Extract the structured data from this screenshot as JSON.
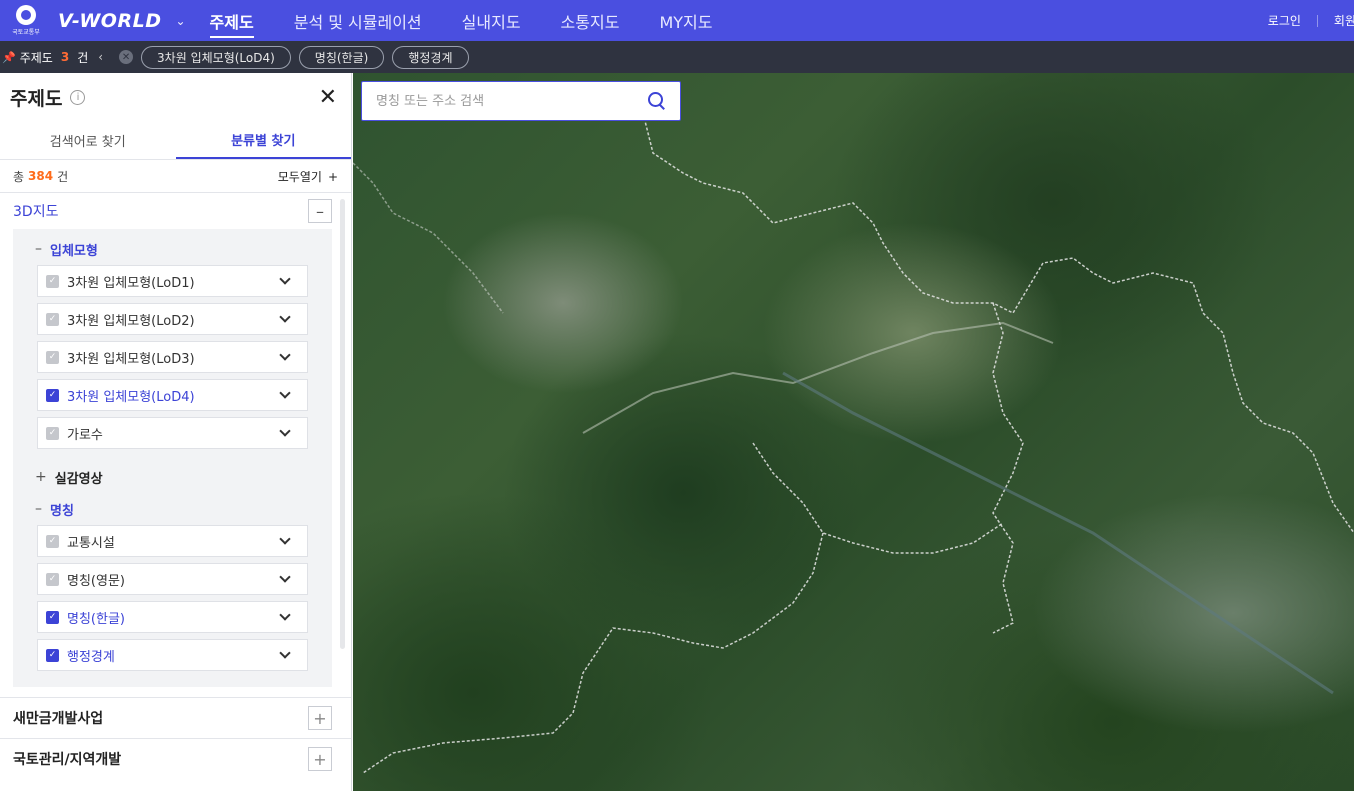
{
  "header": {
    "ministry": "국토교통부",
    "brand": "V-WORLD",
    "nav": [
      "주제도",
      "분석 및 시뮬레이션",
      "실내지도",
      "소통지도",
      "MY지도"
    ],
    "login": "로그인",
    "member": "회원"
  },
  "subbar": {
    "label": "주제도",
    "count": "3",
    "unit": "건",
    "chips": [
      "3차원 입체모형(LoD4)",
      "명칭(한글)",
      "행정경계"
    ]
  },
  "panel": {
    "title": "주제도",
    "tabs": [
      "검색어로 찾기",
      "분류별 찾기"
    ],
    "summary_prefix": "총",
    "summary_count": "384",
    "summary_suffix": "건",
    "expand_all": "모두열기",
    "category_3d": "3D지도",
    "group_model": "입체모형",
    "model_layers": [
      {
        "label": "3차원 입체모형(LoD1)",
        "checked": false
      },
      {
        "label": "3차원 입체모형(LoD2)",
        "checked": false
      },
      {
        "label": "3차원 입체모형(LoD3)",
        "checked": false
      },
      {
        "label": "3차원 입체모형(LoD4)",
        "checked": true
      },
      {
        "label": "가로수",
        "checked": false
      }
    ],
    "group_imagery": "실감영상",
    "group_names": "명칭",
    "name_layers": [
      {
        "label": "교통시설",
        "checked": false
      },
      {
        "label": "명칭(영문)",
        "checked": false
      },
      {
        "label": "명칭(한글)",
        "checked": true
      },
      {
        "label": "행정경계",
        "checked": true
      }
    ],
    "category_2": "새만금개발사업",
    "category_3": "국토관리/지역개발"
  },
  "map": {
    "search_placeholder": "명칭 또는 주소 검색"
  },
  "colors": {
    "brand": "#4a4fe0",
    "accent": "#3c43d6",
    "count": "#ff6b1a"
  }
}
